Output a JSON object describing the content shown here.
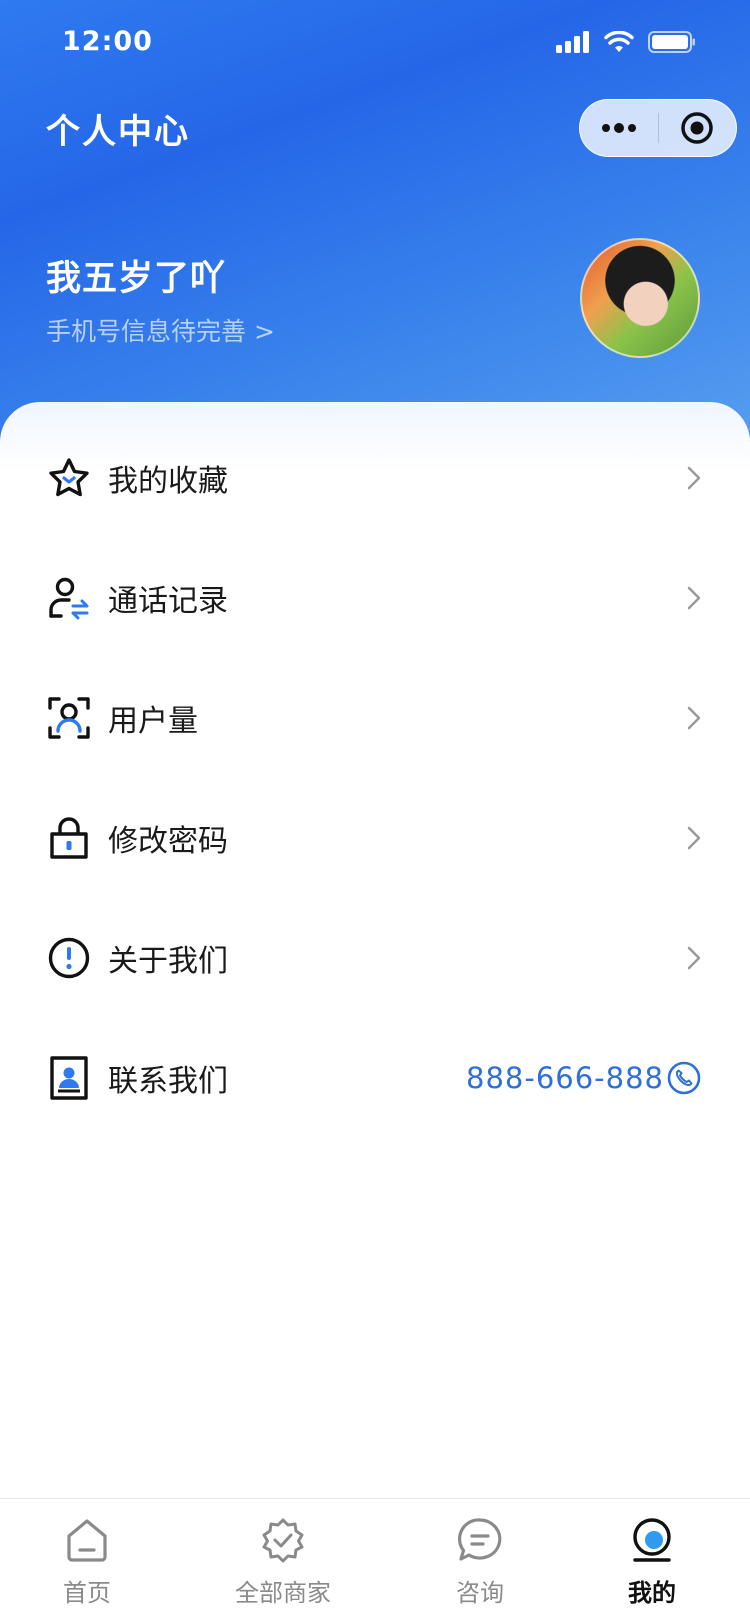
{
  "status_bar": {
    "time": "12:00"
  },
  "header": {
    "title": "个人中心"
  },
  "profile": {
    "name": "我五岁了吖",
    "phone_hint": "手机号信息待完善 >"
  },
  "menu": {
    "items": [
      {
        "label": "我的收藏",
        "icon": "star-icon"
      },
      {
        "label": "通话记录",
        "icon": "user-transfer-icon"
      },
      {
        "label": "用户量",
        "icon": "user-scan-icon"
      },
      {
        "label": "修改密码",
        "icon": "lock-icon"
      },
      {
        "label": "关于我们",
        "icon": "info-circle-icon"
      }
    ],
    "contact": {
      "label": "联系我们",
      "phone": "888-666-888",
      "icon": "contact-card-icon"
    }
  },
  "tabbar": {
    "tabs": [
      {
        "label": "首页",
        "icon": "home-icon"
      },
      {
        "label": "全部商家",
        "icon": "verified-badge-icon"
      },
      {
        "label": "咨询",
        "icon": "chat-icon"
      },
      {
        "label": "我的",
        "icon": "profile-icon",
        "active": true
      }
    ]
  },
  "colors": {
    "accent": "#2f6fd8",
    "header_gradient_start": "#2f7af0",
    "header_gradient_end": "#5aa0f0"
  }
}
